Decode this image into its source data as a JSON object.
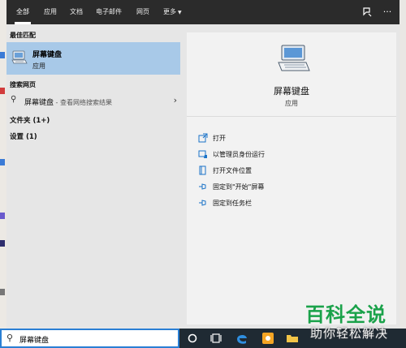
{
  "tabs": [
    "全部",
    "应用",
    "文档",
    "电子邮件",
    "网页",
    "更多"
  ],
  "best_match": {
    "section_title": "最佳匹配",
    "name": "屏幕键盘",
    "type": "应用"
  },
  "web_search": {
    "section_title": "搜索网页",
    "query": "屏幕键盘",
    "hint": " - 查看网络搜索结果"
  },
  "folders_label": "文件夹 (1+)",
  "settings_label": "设置 (1)",
  "detail": {
    "name": "屏幕键盘",
    "type": "应用",
    "actions": [
      "打开",
      "以管理员身份运行",
      "打开文件位置",
      "固定到\"开始\"屏幕",
      "固定到任务栏"
    ]
  },
  "search_box": {
    "value": "屏幕键盘"
  },
  "watermark": {
    "title": "百科全说",
    "subtitle": "助你轻松解决"
  },
  "colors": {
    "selection": "#a8c9e8",
    "accent": "#2a7fd4",
    "watermark_green": "#1aa24a"
  },
  "icons": [
    "search-icon",
    "feedback-icon",
    "more-icon",
    "on-screen-keyboard-icon",
    "chevron-right-icon",
    "open-icon",
    "admin-icon",
    "folder-icon",
    "pin-icon",
    "cortana-icon",
    "task-view-icon",
    "edge-icon"
  ]
}
